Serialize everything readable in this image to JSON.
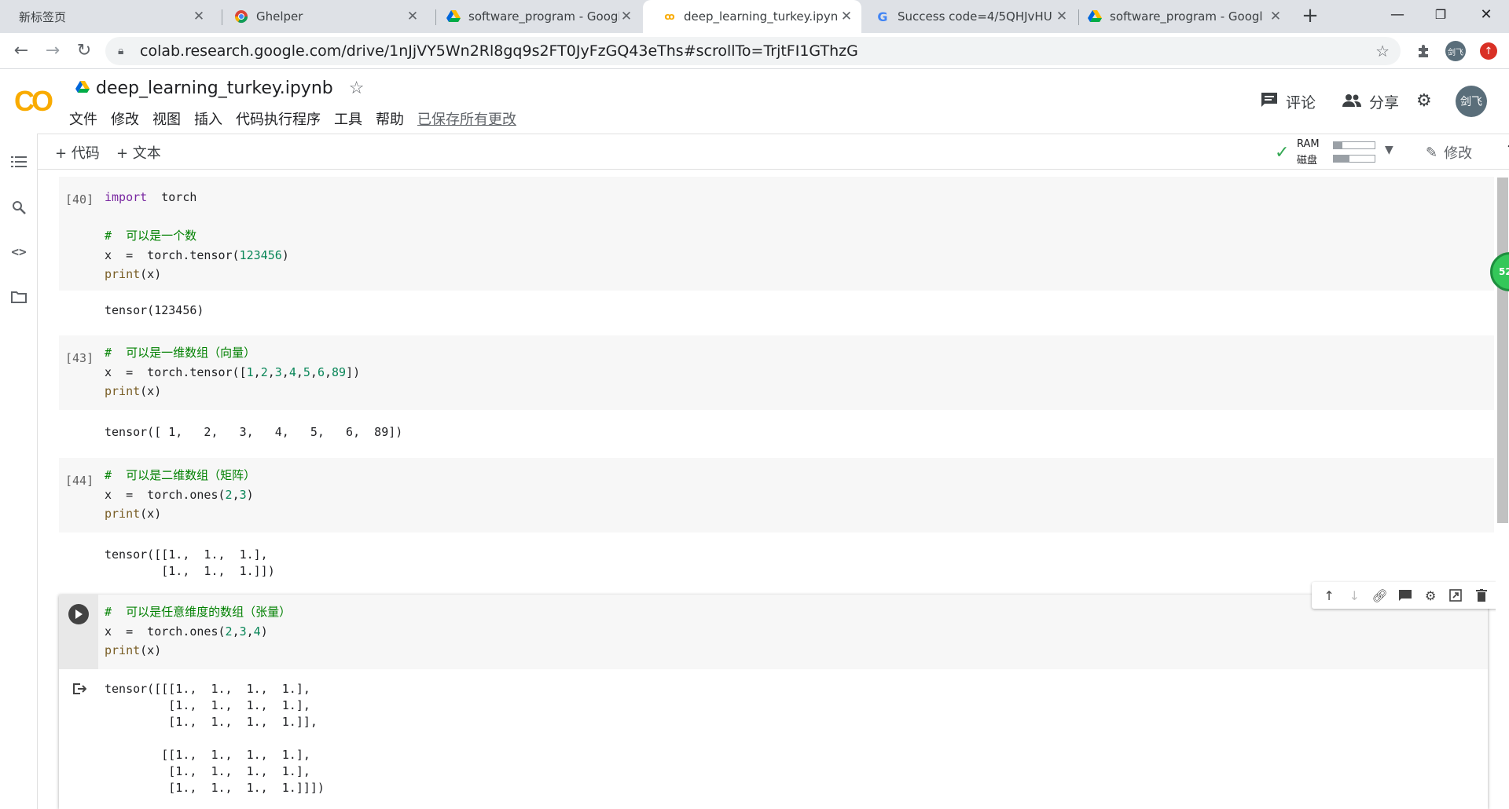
{
  "browser": {
    "tabs": [
      {
        "title": "新标签页"
      },
      {
        "title": "Ghelper"
      },
      {
        "title": "software_program - Googl"
      },
      {
        "title": "deep_learning_turkey.ipyn"
      },
      {
        "title": "Success code=4/5QHJvHU"
      },
      {
        "title": "software_program - Googl"
      }
    ],
    "url": "colab.research.google.com/drive/1nJjVY5Wn2Rl8gq9s2FT0JyFzGQ43eThs#scrollTo=TrjtFI1GThzG",
    "profile_label": "剑飞"
  },
  "colab": {
    "logo": "CO",
    "notebook_title": "deep_learning_turkey.ipynb",
    "menu": [
      "文件",
      "修改",
      "视图",
      "插入",
      "代码执行程序",
      "工具",
      "帮助"
    ],
    "saved_status": "已保存所有更改",
    "comment_label": "评论",
    "share_label": "分享",
    "avatar_label": "剑飞",
    "add_code": "+ 代码",
    "add_text": "+ 文本",
    "ram_label": "RAM",
    "disk_label": "磁盘",
    "ram_usage": 0.22,
    "disk_usage": 0.38,
    "edit_label": "修改",
    "badge_text": "52"
  },
  "cells": [
    {
      "exec": "[40]",
      "code": [
        "import  torch",
        "",
        "#  可以是一个数",
        "x  =  torch.tensor(123456)",
        "print(x)"
      ],
      "output": [
        "tensor(123456)"
      ]
    },
    {
      "exec": "[43]",
      "code": [
        "#  可以是一维数组（向量）",
        "x  =  torch.tensor([1,2,3,4,5,6,89])",
        "print(x)"
      ],
      "output": [
        "tensor([ 1,   2,   3,   4,   5,   6,  89])"
      ]
    },
    {
      "exec": "[44]",
      "code": [
        "#  可以是二维数组（矩阵）",
        "x  =  torch.ones(2,3)",
        "print(x)"
      ],
      "output": [
        "tensor([[1.,  1.,  1.],",
        "        [1.,  1.,  1.]])"
      ]
    },
    {
      "exec": "",
      "code": [
        "#  可以是任意维度的数组（张量）",
        "x  =  torch.ones(2,3,4)",
        "print(x)"
      ],
      "output": [
        "tensor([[[1.,  1.,  1.,  1.],",
        "         [1.,  1.,  1.,  1.],",
        "         [1.,  1.,  1.,  1.]],",
        "",
        "        [[1.,  1.,  1.,  1.],",
        "         [1.,  1.,  1.,  1.],",
        "         [1.,  1.,  1.,  1.]]])"
      ]
    }
  ]
}
